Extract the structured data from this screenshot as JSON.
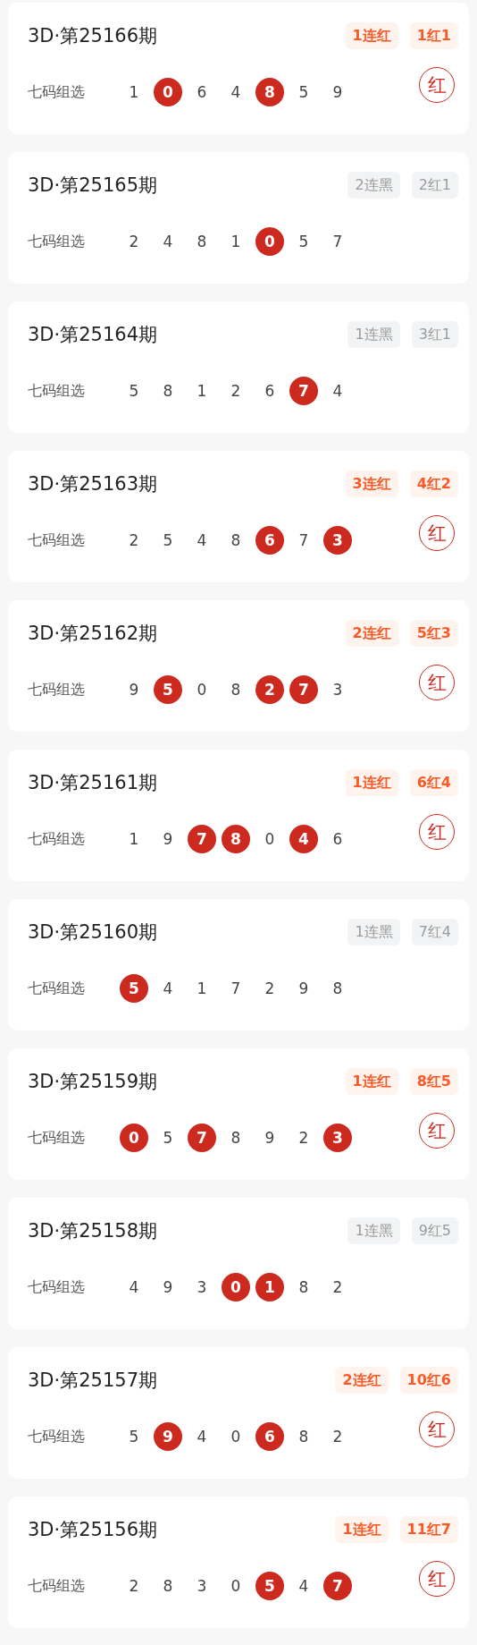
{
  "draws": [
    {
      "period": "3D·第25166期",
      "badges": [
        {
          "text": "1连红",
          "kind": "red"
        },
        {
          "text": "1红1",
          "kind": "red"
        }
      ],
      "label": "七码组选",
      "numbers": [
        {
          "value": "1",
          "hit": false
        },
        {
          "value": "0",
          "hit": true
        },
        {
          "value": "6",
          "hit": false
        },
        {
          "value": "4",
          "hit": false
        },
        {
          "value": "8",
          "hit": true
        },
        {
          "value": "5",
          "hit": false
        },
        {
          "value": "9",
          "hit": false
        }
      ],
      "result": "红"
    },
    {
      "period": "3D·第25165期",
      "badges": [
        {
          "text": "2连黑",
          "kind": "gray"
        },
        {
          "text": "2红1",
          "kind": "gray"
        }
      ],
      "label": "七码组选",
      "numbers": [
        {
          "value": "2",
          "hit": false
        },
        {
          "value": "4",
          "hit": false
        },
        {
          "value": "8",
          "hit": false
        },
        {
          "value": "1",
          "hit": false
        },
        {
          "value": "0",
          "hit": true
        },
        {
          "value": "5",
          "hit": false
        },
        {
          "value": "7",
          "hit": false
        }
      ]
    },
    {
      "period": "3D·第25164期",
      "badges": [
        {
          "text": "1连黑",
          "kind": "gray"
        },
        {
          "text": "3红1",
          "kind": "gray"
        }
      ],
      "label": "七码组选",
      "numbers": [
        {
          "value": "5",
          "hit": false
        },
        {
          "value": "8",
          "hit": false
        },
        {
          "value": "1",
          "hit": false
        },
        {
          "value": "2",
          "hit": false
        },
        {
          "value": "6",
          "hit": false
        },
        {
          "value": "7",
          "hit": true
        },
        {
          "value": "4",
          "hit": false
        }
      ]
    },
    {
      "period": "3D·第25163期",
      "badges": [
        {
          "text": "3连红",
          "kind": "red"
        },
        {
          "text": "4红2",
          "kind": "red"
        }
      ],
      "label": "七码组选",
      "numbers": [
        {
          "value": "2",
          "hit": false
        },
        {
          "value": "5",
          "hit": false
        },
        {
          "value": "4",
          "hit": false
        },
        {
          "value": "8",
          "hit": false
        },
        {
          "value": "6",
          "hit": true
        },
        {
          "value": "7",
          "hit": false
        },
        {
          "value": "3",
          "hit": true
        }
      ],
      "result": "红"
    },
    {
      "period": "3D·第25162期",
      "badges": [
        {
          "text": "2连红",
          "kind": "red"
        },
        {
          "text": "5红3",
          "kind": "red"
        }
      ],
      "label": "七码组选",
      "numbers": [
        {
          "value": "9",
          "hit": false
        },
        {
          "value": "5",
          "hit": true
        },
        {
          "value": "0",
          "hit": false
        },
        {
          "value": "8",
          "hit": false
        },
        {
          "value": "2",
          "hit": true
        },
        {
          "value": "7",
          "hit": true
        },
        {
          "value": "3",
          "hit": false
        }
      ],
      "result": "红"
    },
    {
      "period": "3D·第25161期",
      "badges": [
        {
          "text": "1连红",
          "kind": "red"
        },
        {
          "text": "6红4",
          "kind": "red"
        }
      ],
      "label": "七码组选",
      "numbers": [
        {
          "value": "1",
          "hit": false
        },
        {
          "value": "9",
          "hit": false
        },
        {
          "value": "7",
          "hit": true
        },
        {
          "value": "8",
          "hit": true
        },
        {
          "value": "0",
          "hit": false
        },
        {
          "value": "4",
          "hit": true
        },
        {
          "value": "6",
          "hit": false
        }
      ],
      "result": "红"
    },
    {
      "period": "3D·第25160期",
      "badges": [
        {
          "text": "1连黑",
          "kind": "gray"
        },
        {
          "text": "7红4",
          "kind": "gray"
        }
      ],
      "label": "七码组选",
      "numbers": [
        {
          "value": "5",
          "hit": true
        },
        {
          "value": "4",
          "hit": false
        },
        {
          "value": "1",
          "hit": false
        },
        {
          "value": "7",
          "hit": false
        },
        {
          "value": "2",
          "hit": false
        },
        {
          "value": "9",
          "hit": false
        },
        {
          "value": "8",
          "hit": false
        }
      ]
    },
    {
      "period": "3D·第25159期",
      "badges": [
        {
          "text": "1连红",
          "kind": "red"
        },
        {
          "text": "8红5",
          "kind": "red"
        }
      ],
      "label": "七码组选",
      "numbers": [
        {
          "value": "0",
          "hit": true
        },
        {
          "value": "5",
          "hit": false
        },
        {
          "value": "7",
          "hit": true
        },
        {
          "value": "8",
          "hit": false
        },
        {
          "value": "9",
          "hit": false
        },
        {
          "value": "2",
          "hit": false
        },
        {
          "value": "3",
          "hit": true
        }
      ],
      "result": "红"
    },
    {
      "period": "3D·第25158期",
      "badges": [
        {
          "text": "1连黑",
          "kind": "gray"
        },
        {
          "text": "9红5",
          "kind": "gray"
        }
      ],
      "label": "七码组选",
      "numbers": [
        {
          "value": "4",
          "hit": false
        },
        {
          "value": "9",
          "hit": false
        },
        {
          "value": "3",
          "hit": false
        },
        {
          "value": "0",
          "hit": true
        },
        {
          "value": "1",
          "hit": true
        },
        {
          "value": "8",
          "hit": false
        },
        {
          "value": "2",
          "hit": false
        }
      ]
    },
    {
      "period": "3D·第25157期",
      "badges": [
        {
          "text": "2连红",
          "kind": "red"
        },
        {
          "text": "10红6",
          "kind": "red"
        }
      ],
      "label": "七码组选",
      "numbers": [
        {
          "value": "5",
          "hit": false
        },
        {
          "value": "9",
          "hit": true
        },
        {
          "value": "4",
          "hit": false
        },
        {
          "value": "0",
          "hit": false
        },
        {
          "value": "6",
          "hit": true
        },
        {
          "value": "8",
          "hit": false
        },
        {
          "value": "2",
          "hit": false
        }
      ],
      "result": "红"
    },
    {
      "period": "3D·第25156期",
      "badges": [
        {
          "text": "1连红",
          "kind": "red"
        },
        {
          "text": "11红7",
          "kind": "red"
        }
      ],
      "label": "七码组选",
      "numbers": [
        {
          "value": "2",
          "hit": false
        },
        {
          "value": "8",
          "hit": false
        },
        {
          "value": "3",
          "hit": false
        },
        {
          "value": "0",
          "hit": false
        },
        {
          "value": "5",
          "hit": true
        },
        {
          "value": "4",
          "hit": false
        },
        {
          "value": "7",
          "hit": true
        }
      ],
      "result": "红"
    }
  ]
}
